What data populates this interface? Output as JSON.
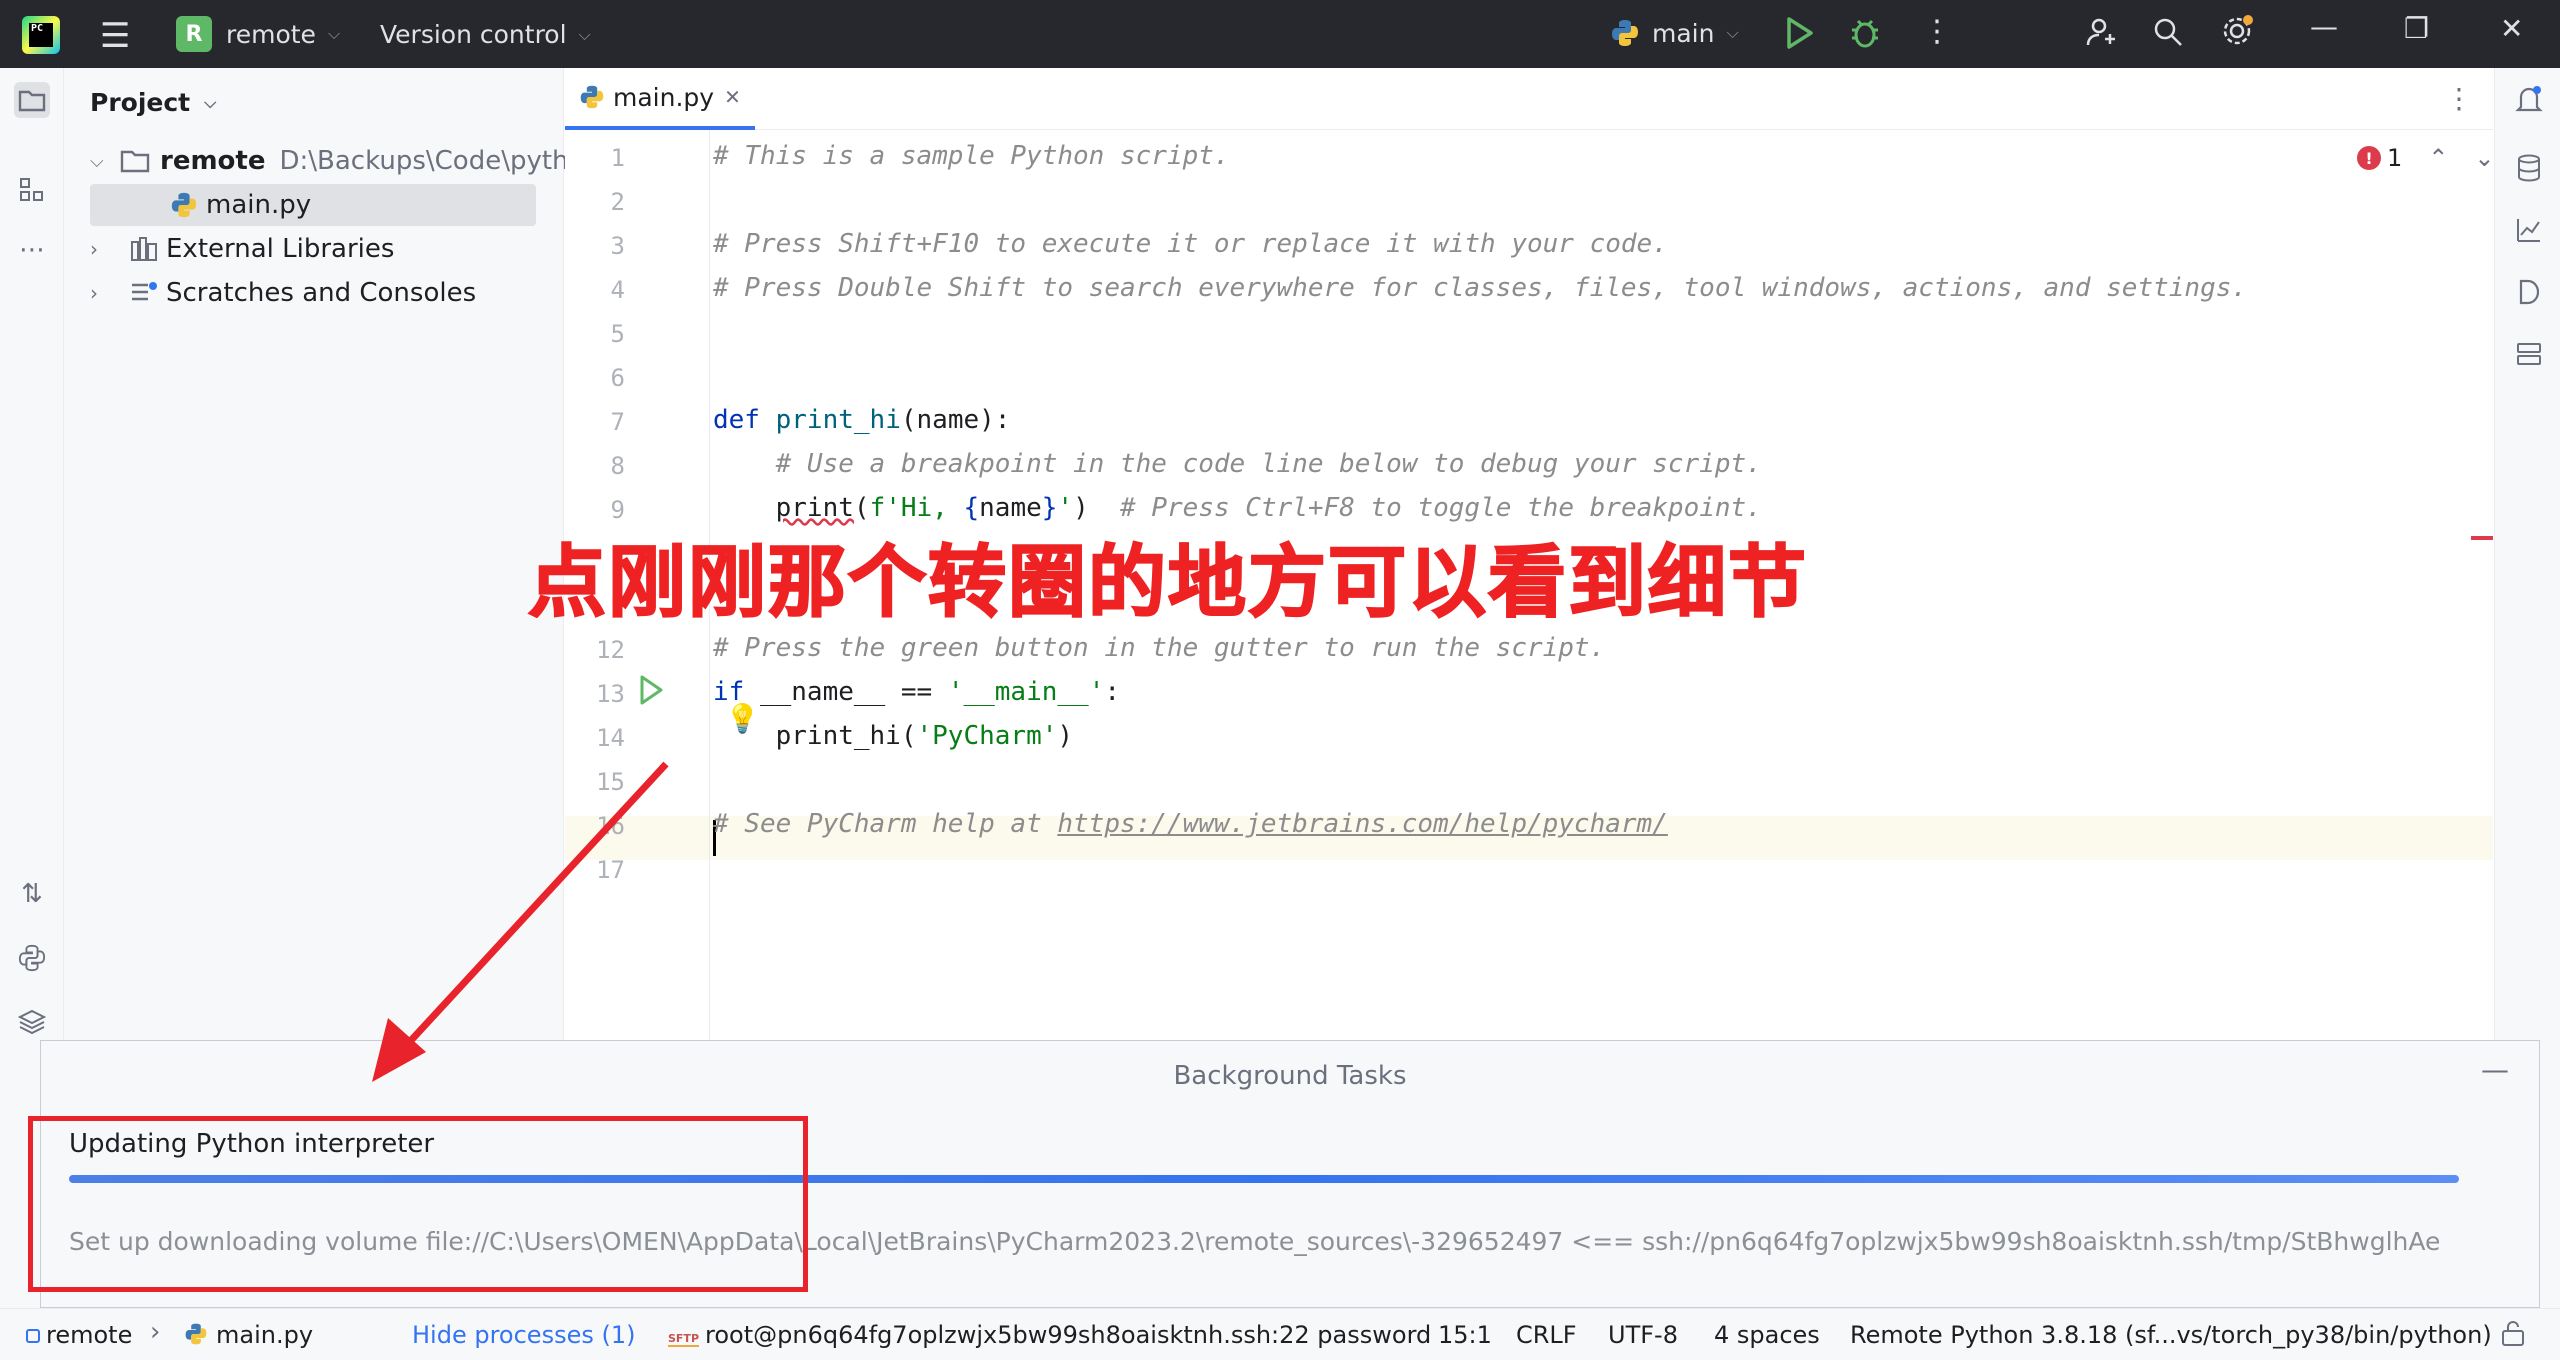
{
  "titlebar": {
    "logo_text": "PC",
    "project_badge": "R",
    "project_name": "remote",
    "vcs_label": "Version control",
    "run_config": "main",
    "minimize": "—",
    "restore": "❐",
    "close": "✕"
  },
  "project_panel": {
    "title": "Project",
    "tree": {
      "root_name": "remote",
      "root_path": "D:\\Backups\\Code\\pytho",
      "file": "main.py",
      "external_libraries": "External Libraries",
      "scratches": "Scratches and Consoles"
    }
  },
  "editor": {
    "tab_label": "main.py",
    "error_count": "1",
    "lines": [
      {
        "n": "1",
        "text": "# This is a sample Python script."
      },
      {
        "n": "2",
        "text": ""
      },
      {
        "n": "3",
        "text": "# Press Shift+F10 to execute it or replace it with your code."
      },
      {
        "n": "4",
        "text": "# Press Double Shift to search everywhere for classes, files, tool windows, actions, and settings."
      },
      {
        "n": "5",
        "text": ""
      },
      {
        "n": "6",
        "text": ""
      },
      {
        "n": "7",
        "text": "def print_hi(name):"
      },
      {
        "n": "8",
        "text": "    # Use a breakpoint in the code line below to debug your script."
      },
      {
        "n": "9",
        "text": "    print(f'Hi, {name}')  # Press Ctrl+F8 to toggle the breakpoint."
      },
      {
        "n": "12",
        "text": "# Press the green button in the gutter to run the script."
      },
      {
        "n": "13",
        "text": "if __name__ == '__main__':"
      },
      {
        "n": "14",
        "text": "    print_hi('PyCharm')"
      },
      {
        "n": "15",
        "text": ""
      },
      {
        "n": "16",
        "text": "# See PyCharm help at https://www.jetbrains.com/help/pycharm/"
      },
      {
        "n": "17",
        "text": ""
      }
    ]
  },
  "annotation": {
    "text": "点刚刚那个转圈的地方可以看到细节"
  },
  "background_tasks": {
    "title": "Background Tasks",
    "minimize": "—",
    "task_name": "Updating Python interpreter",
    "task_detail": "Set up downloading volume file://C:\\Users\\OMEN\\AppData\\Local\\JetBrains\\PyCharm2023.2\\remote_sources\\-329652497 <== ssh://pn6q64fg7oplzwjx5bw99sh8oaisktnh.ssh/tmp/StBhwglhAe",
    "progress": 1.0
  },
  "statusbar": {
    "breadcrumb_project": "remote",
    "breadcrumb_file": "main.py",
    "hide_processes": "Hide processes (1)",
    "sftp_badge": "SFTP",
    "connection": "root@pn6q64fg7oplzwjx5bw99sh8oaisktnh.ssh:22 password",
    "position": "15:1",
    "line_sep": "CRLF",
    "encoding": "UTF-8",
    "indent": "4 spaces",
    "interpreter": "Remote Python 3.8.18 (sf...vs/torch_py38/bin/python)"
  },
  "colors": {
    "accent": "#3574f0",
    "annotation_red": "#e8232b",
    "run_green": "#499c54"
  }
}
